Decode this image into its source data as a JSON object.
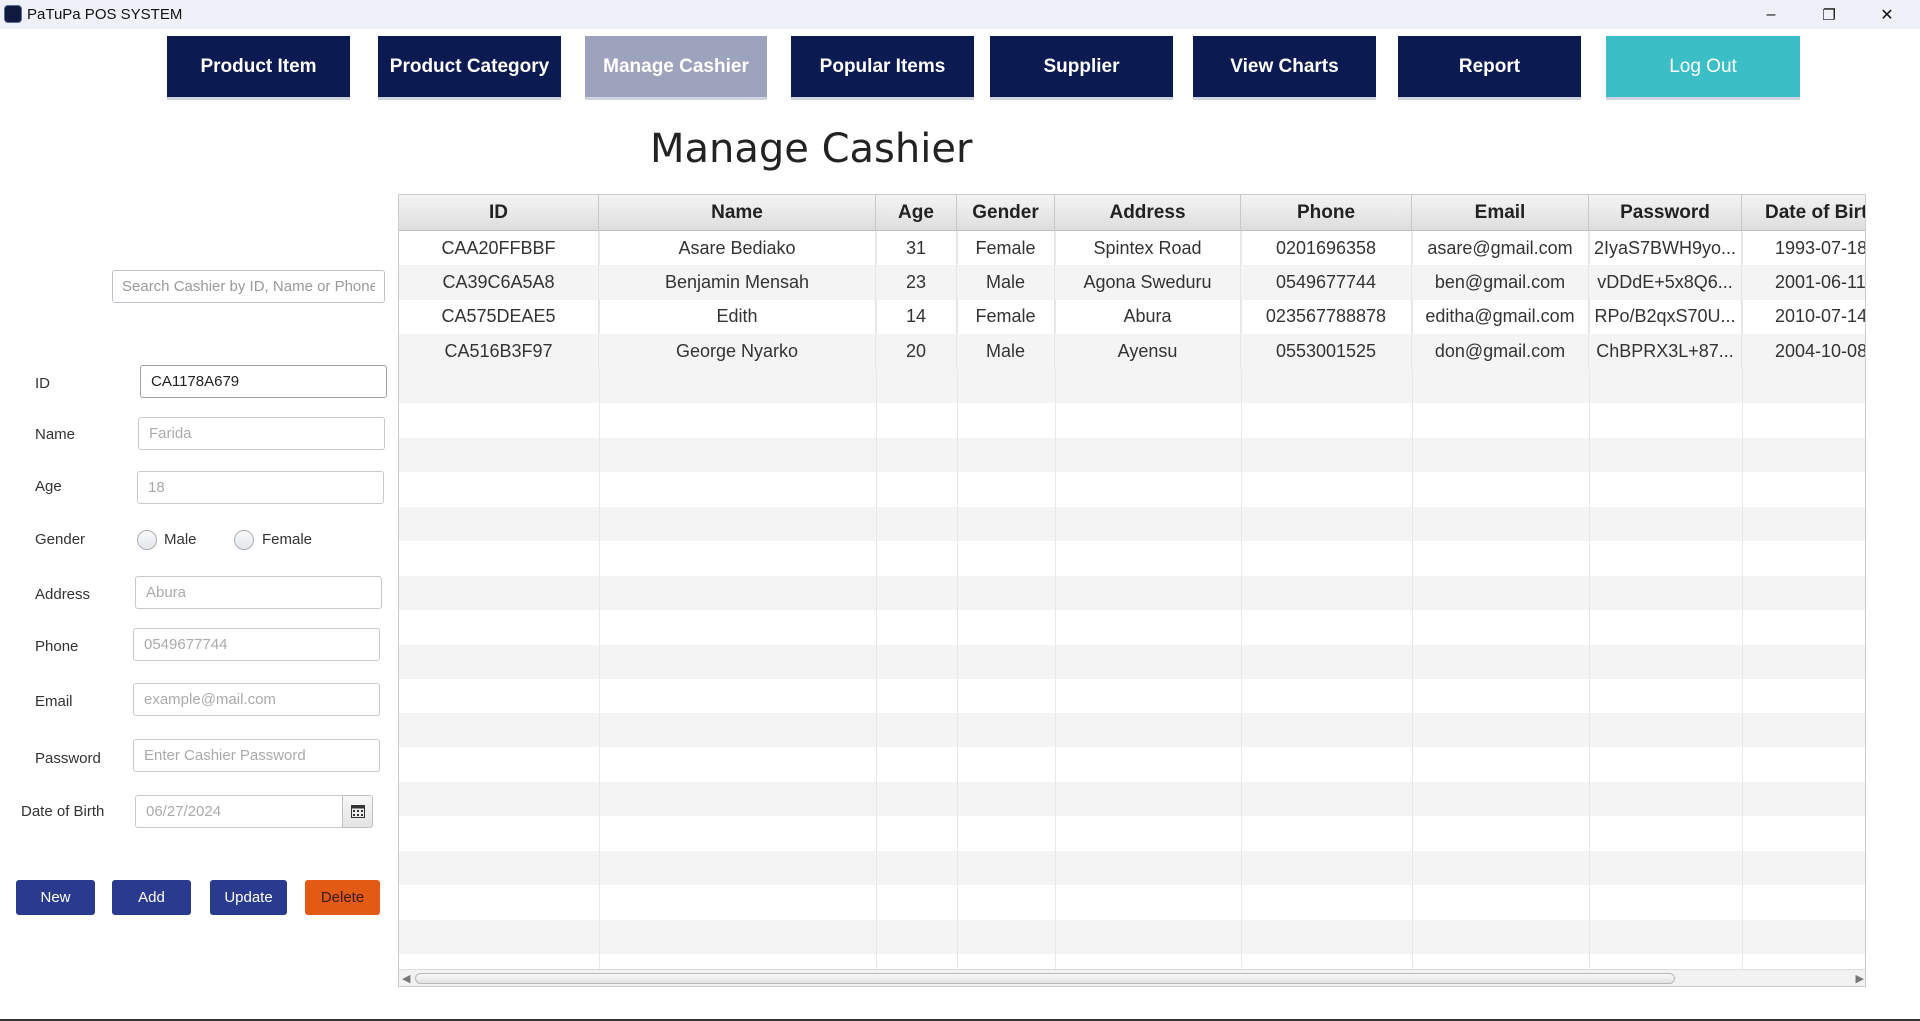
{
  "window": {
    "title": "PaTuPa POS SYSTEM",
    "minimize": "–",
    "restore": "❐",
    "close": "✕"
  },
  "nav": {
    "product_item": "Product Item",
    "product_category": "Product Category",
    "manage_cashier": "Manage Cashier",
    "popular_items": "Popular Items",
    "supplier": "Supplier",
    "view_charts": "View Charts",
    "report": "Report",
    "log_out": "Log Out"
  },
  "page": {
    "title": "Manage Cashier"
  },
  "search": {
    "placeholder": "Search Cashier by ID, Name or Phone"
  },
  "form": {
    "id_label": "ID",
    "id_value": "CA1178A679",
    "name_label": "Name",
    "name_placeholder": "Farida",
    "age_label": "Age",
    "age_placeholder": "18",
    "gender_label": "Gender",
    "male": "Male",
    "female": "Female",
    "address_label": "Address",
    "address_placeholder": "Abura",
    "phone_label": "Phone",
    "phone_placeholder": "0549677744",
    "email_label": "Email",
    "email_placeholder": "example@mail.com",
    "password_label": "Password",
    "password_placeholder": "Enter Cashier Password",
    "dob_label": "Date of Birth",
    "dob_placeholder": "06/27/2024"
  },
  "actions": {
    "new": "New",
    "add": "Add",
    "update": "Update",
    "delete": "Delete"
  },
  "table": {
    "columns": [
      "ID",
      "Name",
      "Age",
      "Gender",
      "Address",
      "Phone",
      "Email",
      "Password",
      "Date of Birth"
    ],
    "rows": [
      [
        "CAA20FFBBF",
        "Asare Bediako",
        "31",
        "Female",
        "Spintex Road",
        "0201696358",
        "asare@gmail.com",
        "2IyaS7BWH9yo...",
        "1993-07-18"
      ],
      [
        "CA39C6A5A8",
        "Benjamin Mensah",
        "23",
        "Male",
        "Agona Sweduru",
        "0549677744",
        "ben@gmail.com",
        "vDDdE+5x8Q6...",
        "2001-06-11"
      ],
      [
        "CA575DEAE5",
        "Edith",
        "14",
        "Female",
        "Abura",
        "023567788878",
        "editha@gmail.com",
        "RPo/B2qxS70U...",
        "2010-07-14"
      ],
      [
        "CA516B3F97",
        "George Nyarko",
        "20",
        "Male",
        "Ayensu",
        "0553001525",
        "don@gmail.com",
        "ChBPRX3L+87...",
        "2004-10-08"
      ]
    ]
  },
  "colors": {
    "nav_bg": "#0c1a52",
    "nav_active": "#9ea3bd",
    "logout": "#3bbec5",
    "action_blue": "#293a8f",
    "delete": "#e35a14"
  }
}
